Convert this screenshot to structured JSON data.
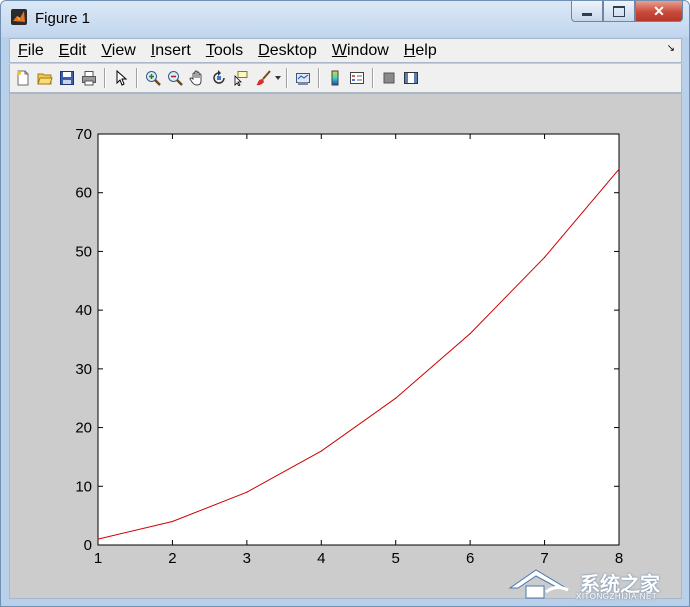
{
  "window": {
    "title": "Figure 1",
    "close_label": "✕"
  },
  "menubar": {
    "items": [
      {
        "mnemonic": "F",
        "rest": "ile"
      },
      {
        "mnemonic": "E",
        "rest": "dit"
      },
      {
        "mnemonic": "V",
        "rest": "iew"
      },
      {
        "mnemonic": "I",
        "rest": "nsert"
      },
      {
        "mnemonic": "T",
        "rest": "ools"
      },
      {
        "mnemonic": "D",
        "rest": "esktop"
      },
      {
        "mnemonic": "W",
        "rest": "indow"
      },
      {
        "mnemonic": "H",
        "rest": "elp"
      }
    ],
    "overflow_arrow": "↘"
  },
  "toolbar": {
    "icons": [
      "new-figure-icon",
      "open-file-icon",
      "save-icon",
      "print-icon",
      "edit-plot-arrow-icon",
      "zoom-in-icon",
      "zoom-out-icon",
      "pan-hand-icon",
      "rotate-3d-icon",
      "data-cursor-icon",
      "brush-icon",
      "link-plot-icon",
      "colorbar-icon",
      "legend-icon",
      "hide-plot-tools-icon",
      "show-plot-tools-icon"
    ]
  },
  "chart_data": {
    "type": "line",
    "x": [
      1,
      2,
      3,
      4,
      5,
      6,
      7,
      8
    ],
    "series": [
      {
        "values": [
          1,
          4,
          9,
          16,
          25,
          36,
          49,
          64
        ],
        "color": "#cc0000"
      }
    ],
    "xlim": [
      1,
      8
    ],
    "ylim": [
      0,
      70
    ],
    "xticks": [
      "1",
      "2",
      "3",
      "4",
      "5",
      "6",
      "7",
      "8"
    ],
    "yticks": [
      "0",
      "10",
      "20",
      "30",
      "40",
      "50",
      "60",
      "70"
    ],
    "grid": false,
    "title": "",
    "xlabel": "",
    "ylabel": ""
  },
  "watermark": {
    "text": "系统之家",
    "subtext": "XITONGZHIJIA.NET"
  },
  "colors": {
    "figure_bg": "#cccccc",
    "axes_bg": "#ffffff",
    "line": "#cc0000"
  }
}
